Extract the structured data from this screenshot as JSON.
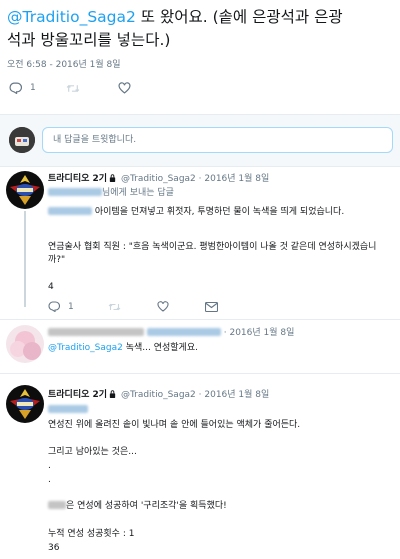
{
  "main_tweet": {
    "mention": "@Traditio_Saga2",
    "text_line1_rest": " 또 왔어요. (솥에 은광석과 은광",
    "text_line2": "석과 방울꼬리를 넣는다.)",
    "timestamp": "오전 6:58 - 2016년 1월 8일",
    "reply_count": "1",
    "retweet_count": "",
    "like_count": ""
  },
  "reply_box": {
    "placeholder": "내 답글을 트윗합니다."
  },
  "replies": [
    {
      "name": "트라디티오 2기",
      "handle": "@Traditio_Saga2",
      "date": "· 2016년 1월 8일",
      "replying_to": "님에게 보내는 답글",
      "lines": [
        "아이템을 던져넣고 휘젓자, 투명하던 물이 녹색을 띄게 되었습니다.",
        "",
        "연금술사 협회 직원 : \"흐음 녹색이군요. 평범한아이템이 나올 것 같은데 연성하시겠습니",
        "까?\"",
        "",
        "4"
      ],
      "reply_count": "1"
    },
    {
      "name": "",
      "handle": "",
      "date": "· 2016년 1월 8일",
      "mention": "@Traditio_Saga2",
      "text": " 녹색... 연성할게요."
    },
    {
      "name": "트라디티오 2기",
      "handle": "@Traditio_Saga2",
      "date": "· 2016년 1월 8일",
      "lines": [
        "연성진 위에 올려진 솥이 빛나며 솥 안에 들어있는 액체가 줄어든다.",
        "",
        "그리고 남아있는 것은...",
        ".",
        ".",
        "",
        "은 연성에 성공하여 '구리조각'을 획득했다!",
        "",
        "누적 연성 성공횟수 : 1",
        "36"
      ]
    }
  ],
  "colors": {
    "link": "#1da1f2",
    "secondary_text": "#657786",
    "divider": "#e6ecf0",
    "thread_line": "#ccd6dd"
  }
}
